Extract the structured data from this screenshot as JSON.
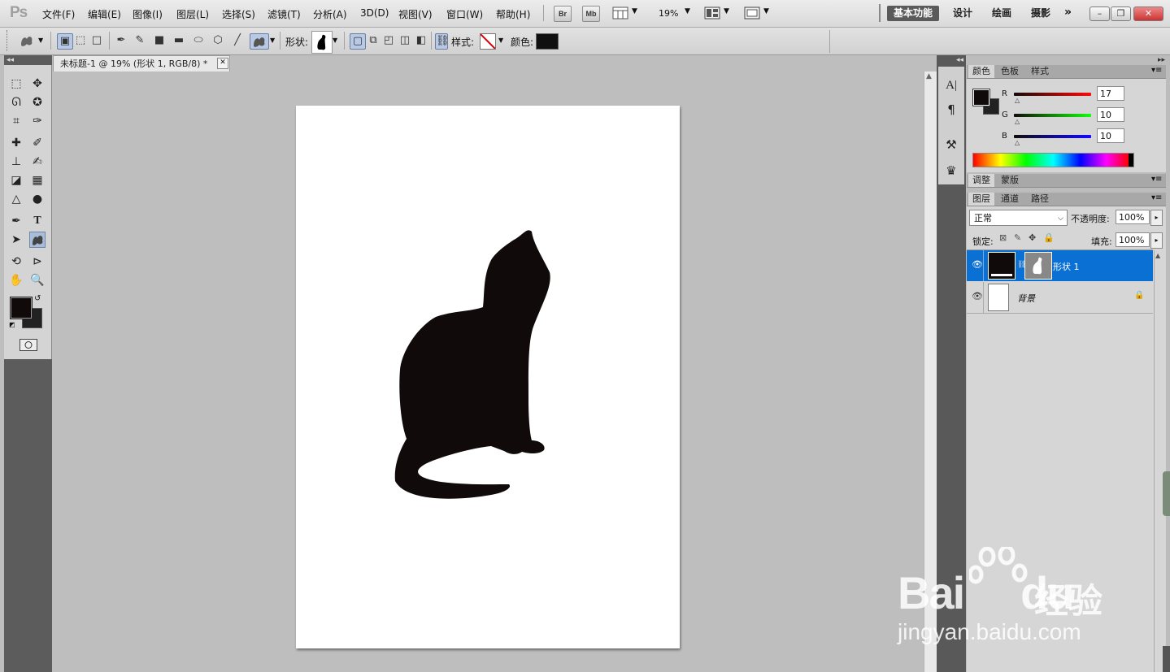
{
  "app": {
    "logo": "Ps"
  },
  "menu": [
    "文件(F)",
    "编辑(E)",
    "图像(I)",
    "图层(L)",
    "选择(S)",
    "滤镜(T)",
    "分析(A)",
    "3D(D)",
    "视图(V)",
    "窗口(W)",
    "帮助(H)"
  ],
  "appbar": {
    "bridge": "Br",
    "minibridge": "Mb",
    "zoom": "19%"
  },
  "workspaces": [
    "基本功能",
    "设计",
    "绘画",
    "摄影"
  ],
  "window_controls": {
    "min": "–",
    "restore": "❐",
    "close": "✕"
  },
  "options": {
    "shape_label": "形状:",
    "style_label": "样式:",
    "color_label": "颜色:",
    "fill_color": "#111010"
  },
  "document": {
    "tab_title": "未标题-1 @ 19% (形状 1, RGB/8) *",
    "close": "✕"
  },
  "color_panel": {
    "tabs": [
      "颜色",
      "色板",
      "样式"
    ],
    "r_label": "R",
    "g_label": "G",
    "b_label": "B",
    "r_value": "17",
    "g_value": "10",
    "b_value": "10",
    "fg_color": "#110a0a",
    "bg_color": "#222222"
  },
  "adjust_panel": {
    "tabs": [
      "调整",
      "蒙版"
    ]
  },
  "layers_panel": {
    "tabs": [
      "图层",
      "通道",
      "路径"
    ],
    "blend_mode": "正常",
    "opacity_label": "不透明度:",
    "opacity_value": "100%",
    "lock_label": "锁定:",
    "fill_label": "填充:",
    "fill_value": "100%",
    "layers": [
      {
        "name": "形状 1",
        "selected": true
      },
      {
        "name": "背景",
        "selected": false
      }
    ]
  },
  "watermark": {
    "brand": "Bai",
    "brand2": "du",
    "cn": "经验",
    "url": "jingyan.baidu.com"
  }
}
